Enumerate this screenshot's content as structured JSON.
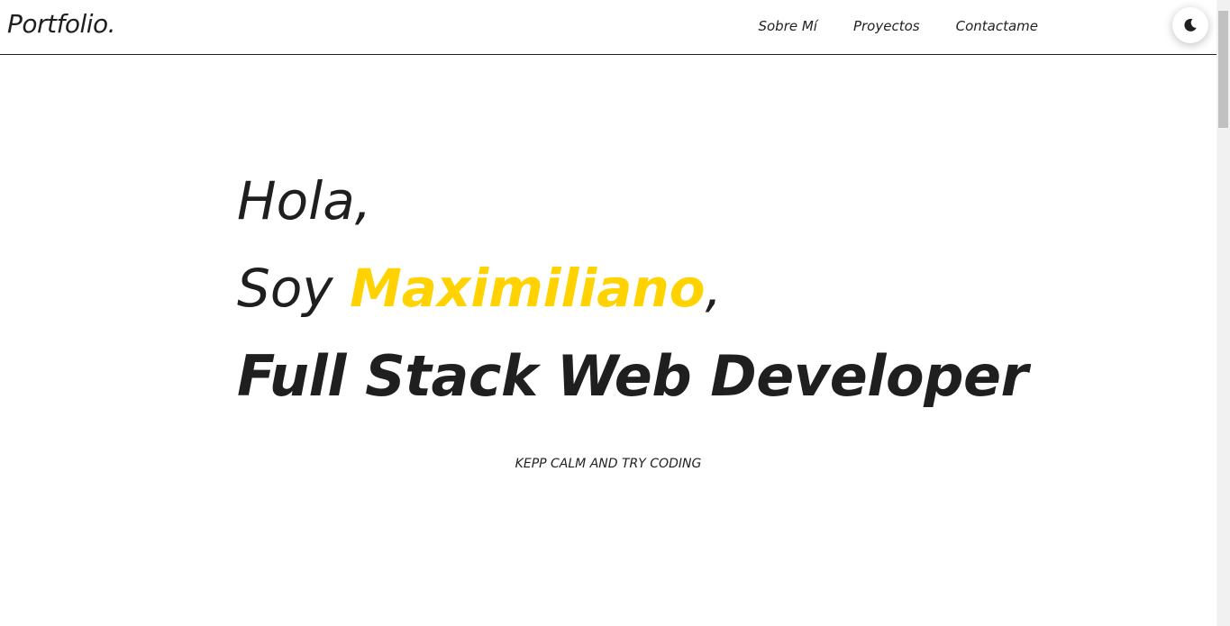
{
  "navbar": {
    "logo": "Portfolio.",
    "links": [
      {
        "label": "Sobre Mí"
      },
      {
        "label": "Proyectos"
      },
      {
        "label": "Contactame"
      }
    ],
    "theme_toggle_icon": "moon-icon"
  },
  "hero": {
    "greeting": "Hola,",
    "intro_prefix": "Soy ",
    "name": "Maximiliano",
    "intro_suffix": ",",
    "role": "Full Stack Web Developer"
  },
  "tagline": "KEPP CALM AND TRY CODING",
  "colors": {
    "accent": "#ffd200",
    "text": "#1f1f1f",
    "background": "#ffffff"
  }
}
